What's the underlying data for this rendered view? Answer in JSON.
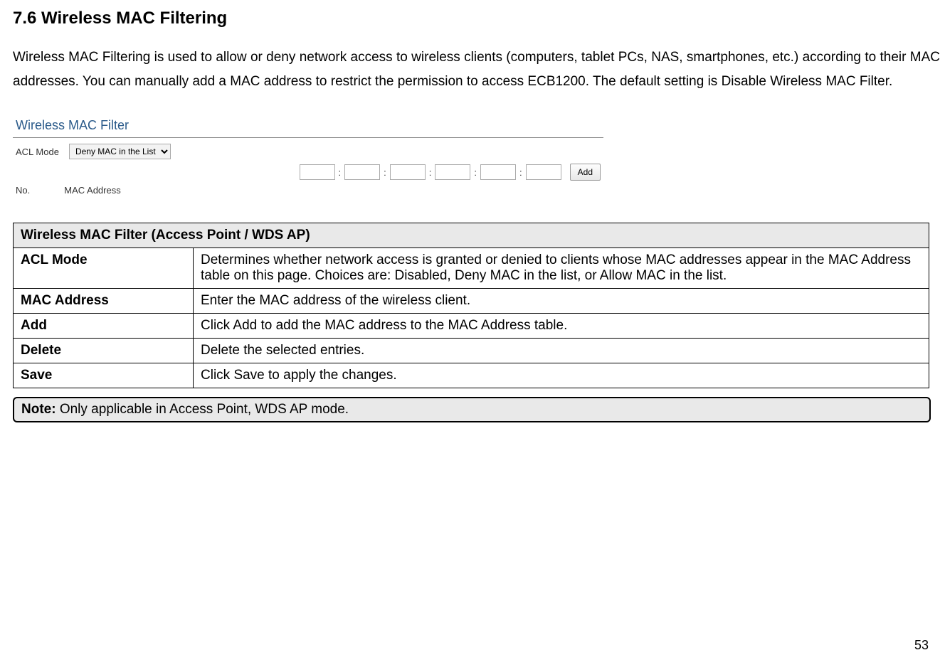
{
  "heading": "7.6  Wireless MAC Filtering",
  "intro": "Wireless MAC Filtering is used to allow or deny network access to wireless clients (computers, tablet PCs, NAS, smartphones, etc.) according to their MAC addresses. You can manually add a MAC address to restrict the permission to access ECB1200. The default setting is Disable Wireless MAC Filter.",
  "screenshot": {
    "title": "Wireless MAC Filter",
    "acl_label": "ACL Mode",
    "acl_value": "Deny MAC in the List",
    "add_button": "Add",
    "col_no": "No.",
    "col_mac": "MAC Address"
  },
  "table": {
    "header": "Wireless MAC Filter (Access Point / WDS AP)",
    "rows": [
      {
        "key": "ACL Mode",
        "desc": "Determines whether network access is granted or denied to clients whose MAC addresses appear in the MAC Address table on this page. Choices are: Disabled, Deny MAC in the list, or Allow MAC in the list."
      },
      {
        "key": "MAC Address",
        "desc": "Enter the MAC address of the wireless client."
      },
      {
        "key": "Add",
        "desc": "Click Add to add the MAC address to the MAC Address table."
      },
      {
        "key": "Delete",
        "desc": "Delete the selected entries."
      },
      {
        "key": "Save",
        "desc": "Click Save to apply the changes."
      }
    ]
  },
  "note_label": "Note:",
  "note_text": " Only applicable in Access Point, WDS AP mode.",
  "page_number": "53"
}
